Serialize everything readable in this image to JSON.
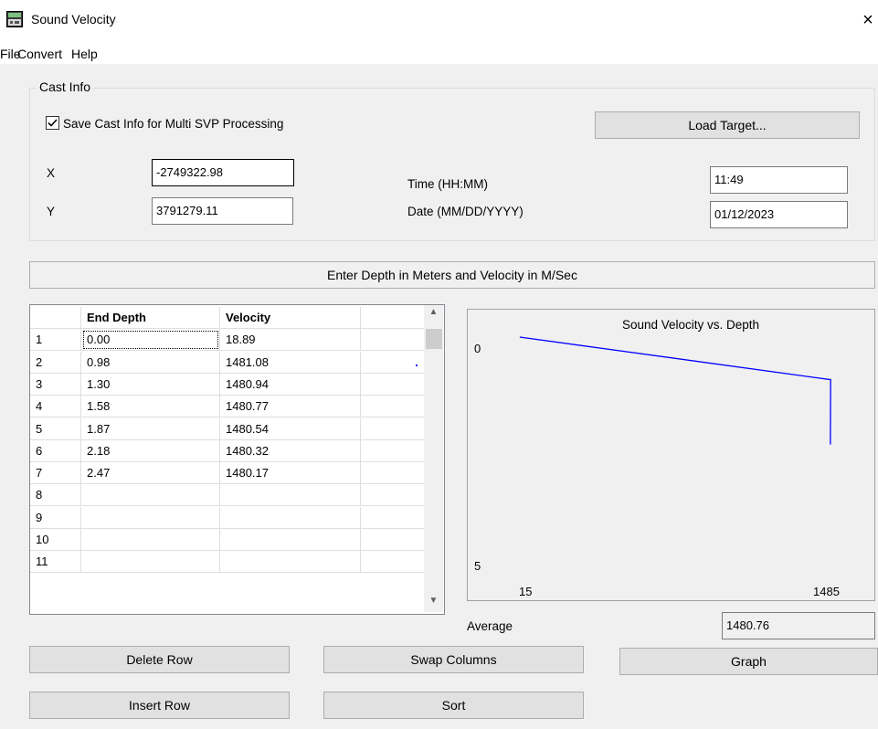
{
  "window": {
    "title": "Sound Velocity",
    "close_glyph": "×"
  },
  "menu": [
    "File",
    "Convert",
    "Help"
  ],
  "cast_info": {
    "legend": "Cast Info",
    "save_checkbox_label": "Save Cast Info for Multi SVP Processing",
    "save_checked": true,
    "load_button": "Load Target...",
    "x_label": "X",
    "x_value": "-2749322.98",
    "y_label": "Y",
    "y_value": "3791279.11",
    "time_label": "Time (HH:MM)",
    "time_value": "11:49",
    "date_label": "Date (MM/DD/YYYY)",
    "date_value": "01/12/2023"
  },
  "banner": "Enter Depth in Meters and Velocity in M/Sec",
  "grid": {
    "headers": [
      "",
      "End Depth",
      "Velocity"
    ],
    "rows": [
      [
        "1",
        "0.00",
        "18.89"
      ],
      [
        "2",
        "0.98",
        "1481.08"
      ],
      [
        "3",
        "1.30",
        "1480.94"
      ],
      [
        "4",
        "1.58",
        "1480.77"
      ],
      [
        "5",
        "1.87",
        "1480.54"
      ],
      [
        "6",
        "2.18",
        "1480.32"
      ],
      [
        "7",
        "2.47",
        "1480.17"
      ],
      [
        "8",
        "",
        ""
      ],
      [
        "9",
        "",
        ""
      ],
      [
        "10",
        "",
        ""
      ],
      [
        "11",
        "",
        ""
      ]
    ]
  },
  "chart_data": {
    "type": "line",
    "title": "Sound Velocity vs. Depth",
    "y_tick_top": "0",
    "y_tick_bottom": "5",
    "x_tick_left": "15",
    "x_tick_right": "1485",
    "x_range": [
      15,
      1485
    ],
    "y_range": [
      0,
      5
    ],
    "line_color": "#0000ff",
    "series": [
      {
        "points": [
          [
            18.89,
            0.0
          ],
          [
            1481.08,
            0.98
          ],
          [
            1480.94,
            1.3
          ],
          [
            1480.77,
            1.58
          ],
          [
            1480.54,
            1.87
          ],
          [
            1480.32,
            2.18
          ],
          [
            1480.17,
            2.47
          ]
        ]
      }
    ]
  },
  "average": {
    "label": "Average",
    "value": "1480.76"
  },
  "buttons": {
    "delete_row": "Delete Row",
    "swap_columns": "Swap Columns",
    "graph": "Graph",
    "insert_row": "Insert Row",
    "sort": "Sort"
  },
  "icons": {
    "app": "window-app-icon",
    "up": "▲",
    "down": "▼"
  }
}
